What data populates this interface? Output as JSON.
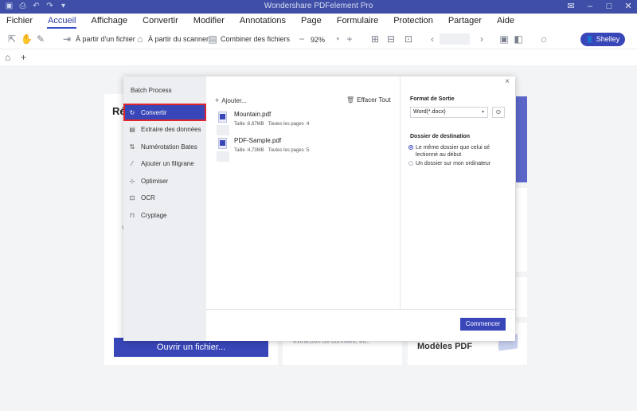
{
  "app": {
    "title": "Wondershare PDFelement Pro",
    "quick_access_icons": [
      "save-icon",
      "print-icon",
      "undo-icon",
      "redo-icon",
      "dropdown-icon"
    ],
    "window_controls": [
      "mail-icon",
      "minimize-icon",
      "maximize-icon",
      "close-icon"
    ]
  },
  "menu": [
    "Fichier",
    "Accueil",
    "Affichage",
    "Convertir",
    "Modifier",
    "Annotations",
    "Page",
    "Formulaire",
    "Protection",
    "Partager",
    "Aide"
  ],
  "menu_active": "Accueil",
  "toolbar": {
    "from_file": "À partir d'un fichier",
    "from_scanner": "À partir du scanner",
    "combine": "Combiner des fichiers",
    "zoom_minus": "−",
    "zoom": "92%",
    "zoom_plus": "+",
    "user": "Shelley"
  },
  "background": {
    "recent_heading": "Ré",
    "recent_partial": "V",
    "open_button": "Ouvrir un fichier...",
    "mid_card_text": "extraction de données, etc.",
    "templates_card": "Modèles PDF"
  },
  "dialog": {
    "title": "Batch Process",
    "close": "×",
    "sidebar": [
      {
        "label": "Convertir",
        "icon": "convert-icon",
        "glyph": "↻"
      },
      {
        "label": "Extraire des données",
        "icon": "extract-icon",
        "glyph": "▤"
      },
      {
        "label": "Numérotation Bates",
        "icon": "bates-icon",
        "glyph": "⇅"
      },
      {
        "label": "Ajouter un filigrane",
        "icon": "watermark-icon",
        "glyph": "⁄"
      },
      {
        "label": "Optimiser",
        "icon": "optimize-icon",
        "glyph": "⊹"
      },
      {
        "label": "OCR",
        "icon": "ocr-icon",
        "glyph": "⊡"
      },
      {
        "label": "Cryptage",
        "icon": "lock-icon",
        "glyph": "⊓"
      }
    ],
    "add": "Ajouter...",
    "clear": "Effacer Tout",
    "files": [
      {
        "name": "Mountain.pdf",
        "size": "Taille :6,87MB",
        "pages": "Toutes les pages :4"
      },
      {
        "name": "PDF-Sample.pdf",
        "size": "Taille :4,73MB",
        "pages": "Toutes les pages :5"
      }
    ],
    "output_format_label": "Format de Sortie",
    "output_format": "Word(*.docx)",
    "destination_label": "Dossier de destination",
    "dest_options": [
      "Le même dossier que celui sé lectionné au début",
      "Un dossier sur mon ordinateur"
    ],
    "dest_selected": 0,
    "convert_button": "Commencer"
  }
}
